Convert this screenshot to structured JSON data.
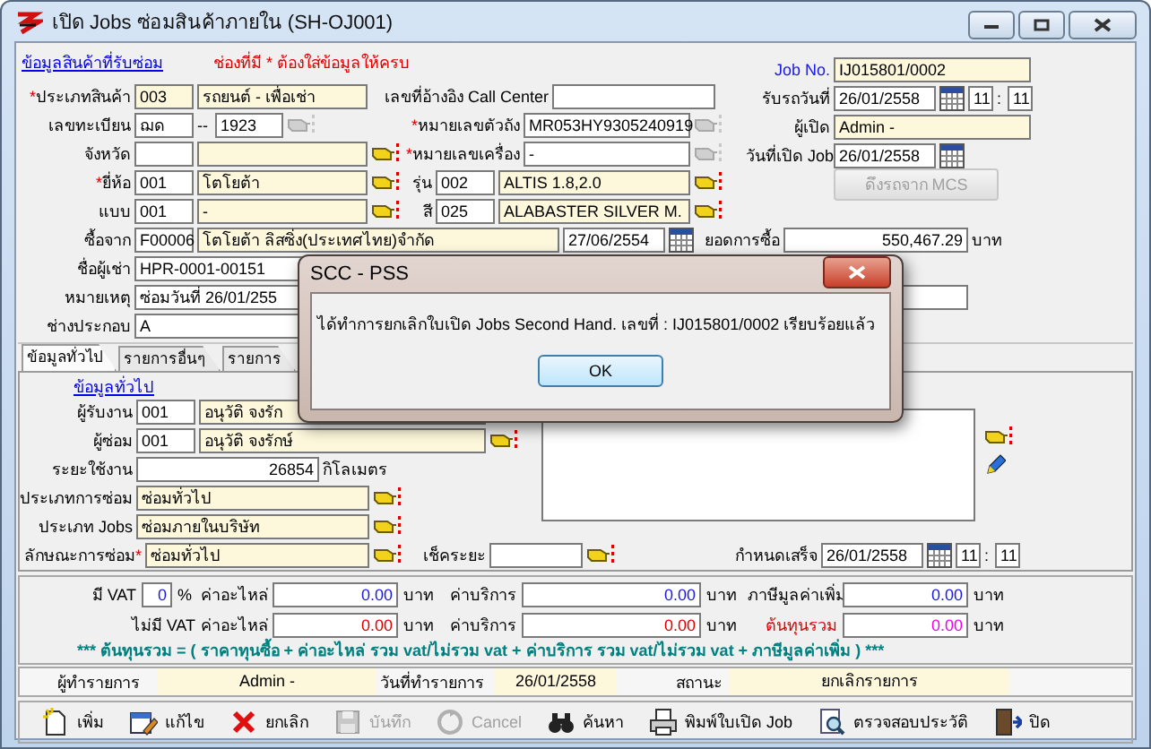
{
  "window": {
    "title": "เปิด Jobs ซ่อมสินค้าภายใน (SH-OJ001)"
  },
  "product_section": {
    "link": "ข้อมูลสินค้าที่รับซ่อม",
    "note": "ช่องที่มี * ต้องใส่ข้อมูลให้ครบ",
    "rows": [
      {
        "items": [
          {
            "kind": "label",
            "mark": "*",
            "text": "ประเภทสินค้า"
          },
          {
            "kind": "field",
            "value": "003",
            "readonly": true
          },
          {
            "kind": "field",
            "value": "รถยนต์ - เพื่อเช่า",
            "readonly": true
          },
          {
            "kind": "label",
            "text": "เลขที่อ้างอิง Call Center"
          },
          {
            "kind": "field",
            "readonly": false
          }
        ]
      },
      {
        "items": [
          {
            "kind": "label",
            "text": "เลขทะเบียน"
          },
          {
            "kind": "field",
            "value": "ฌด",
            "readonly": false
          },
          {
            "kind": "text",
            "text": "--"
          },
          {
            "kind": "field",
            "value": "1923",
            "readonly": false
          },
          {
            "kind": "picker",
            "disabled": true
          },
          {
            "kind": "label",
            "mark": "*",
            "text": "หมายเลขตัวถัง"
          },
          {
            "kind": "field",
            "value": "MR053HY9305240919",
            "readonly": false
          },
          {
            "kind": "picker",
            "disabled": true
          }
        ]
      },
      {
        "items": [
          {
            "kind": "label",
            "text": "จังหวัด"
          },
          {
            "kind": "field",
            "readonly": false
          },
          {
            "kind": "field",
            "readonly": true
          },
          {
            "kind": "picker",
            "disabled": false
          },
          {
            "kind": "label",
            "mark": "*",
            "text": "หมายเลขเครื่อง"
          },
          {
            "kind": "field",
            "value": "-",
            "readonly": false
          },
          {
            "kind": "picker",
            "disabled": true
          }
        ]
      },
      {
        "items": [
          {
            "kind": "label",
            "mark": "*",
            "text": "ยี่ห้อ"
          },
          {
            "kind": "field",
            "value": "001",
            "readonly": false
          },
          {
            "kind": "field",
            "value": "โตโยต้า",
            "readonly": true
          },
          {
            "kind": "picker",
            "disabled": false
          },
          {
            "kind": "label",
            "text": "รุ่น"
          },
          {
            "kind": "field",
            "value": "002",
            "readonly": false
          },
          {
            "kind": "field",
            "value": "ALTIS 1.8,2.0",
            "readonly": true
          },
          {
            "kind": "picker",
            "disabled": false
          }
        ]
      },
      {
        "items": [
          {
            "kind": "label",
            "text": "แบบ"
          },
          {
            "kind": "field",
            "value": "001",
            "readonly": false
          },
          {
            "kind": "field",
            "value": "-",
            "readonly": true
          },
          {
            "kind": "picker",
            "disabled": false
          },
          {
            "kind": "label",
            "text": "สี"
          },
          {
            "kind": "field",
            "value": "025",
            "readonly": false
          },
          {
            "kind": "field",
            "value": "ALABASTER SILVER M.",
            "readonly": true
          },
          {
            "kind": "picker",
            "disabled": false
          }
        ]
      }
    ],
    "job": [
      {
        "items": [
          {
            "kind": "label",
            "color": "#1a1ae6",
            "text": "Job No."
          },
          {
            "kind": "field",
            "value": "IJ015801/0002",
            "readonly": true
          }
        ]
      },
      {
        "items": [
          {
            "kind": "label",
            "text": "รับรถวันที่"
          },
          {
            "kind": "field",
            "value": "26/01/2558",
            "readonly": false
          },
          {
            "kind": "calendar"
          },
          {
            "kind": "field",
            "value": "11",
            "readonly": false
          },
          {
            "kind": "text",
            "text": ":"
          },
          {
            "kind": "field",
            "value": "11",
            "readonly": false
          }
        ]
      },
      {
        "items": [
          {
            "kind": "label",
            "text": "ผู้เปิด"
          },
          {
            "kind": "field",
            "value": "Admin -",
            "readonly": true
          }
        ]
      },
      {
        "items": [
          {
            "kind": "label",
            "text": "วันที่เปิด Job"
          },
          {
            "kind": "field",
            "value": "26/01/2558",
            "readonly": false
          },
          {
            "kind": "calendar"
          }
        ]
      },
      {
        "items": [
          {
            "kind": "button",
            "text": "ดึงรถจาก MCS",
            "disabled": true
          }
        ]
      }
    ],
    "more_rows": [
      {
        "items": [
          {
            "kind": "label",
            "text": "ซื้อจาก"
          },
          {
            "kind": "field",
            "value": "F00006",
            "readonly": false
          },
          {
            "kind": "field",
            "value": "โตโยต้า ลิสซิ่ง(ประเทศไทย)จำกัด",
            "readonly": true
          },
          {
            "kind": "field",
            "value": "27/06/2554",
            "readonly": false
          },
          {
            "kind": "calendar"
          },
          {
            "kind": "label",
            "text": "ยอดการซื้อ"
          },
          {
            "kind": "field",
            "value": "550,467.29",
            "readonly": false
          },
          {
            "kind": "text",
            "text": "บาท"
          }
        ]
      },
      {
        "items": [
          {
            "kind": "label",
            "text": "ชื่อผู้เช่า"
          },
          {
            "kind": "field",
            "value": "HPR-0001-00151",
            "readonly": false
          }
        ]
      },
      {
        "items": [
          {
            "kind": "label",
            "text": "หมายเหตุ"
          },
          {
            "kind": "field",
            "value": "ซ่อมวันที่ 26/01/255",
            "readonly": false
          }
        ]
      },
      {
        "items": [
          {
            "kind": "label",
            "text": "ช่างประกอบ"
          },
          {
            "kind": "field",
            "value": "A",
            "readonly": false
          }
        ]
      }
    ]
  },
  "tabs": [
    {
      "label": "ข้อมูลทั่วไป",
      "selected": true
    },
    {
      "label": "รายการอื่นๆ",
      "selected": false
    },
    {
      "label": "รายการ",
      "selected": false
    }
  ],
  "general": {
    "link": "ข้อมูลทั่วไป",
    "rows": [
      {
        "items": [
          {
            "kind": "label",
            "text": "ผู้รับงาน"
          },
          {
            "kind": "field",
            "value": "001",
            "readonly": false
          },
          {
            "kind": "field",
            "value": "อนุวัติ จงรัก",
            "readonly": true
          }
        ]
      },
      {
        "items": [
          {
            "kind": "label",
            "text": "ผู้ซ่อม"
          },
          {
            "kind": "field",
            "value": "001",
            "readonly": false
          },
          {
            "kind": "field",
            "value": "อนุวัติ จงรักษ์",
            "readonly": true
          },
          {
            "kind": "picker",
            "disabled": false
          }
        ]
      },
      {
        "items": [
          {
            "kind": "label",
            "text": "ระยะใช้งาน"
          },
          {
            "kind": "field",
            "value": "26854",
            "readonly": false
          },
          {
            "kind": "text",
            "text": "กิโลเมตร"
          }
        ]
      },
      {
        "items": [
          {
            "kind": "label",
            "text": "ประเภทการซ่อม"
          },
          {
            "kind": "field",
            "value": "ซ่อมทั่วไป",
            "readonly": true
          },
          {
            "kind": "picker",
            "disabled": false
          }
        ]
      },
      {
        "items": [
          {
            "kind": "label",
            "text": "ประเภท Jobs"
          },
          {
            "kind": "field",
            "value": "ซ่อมภายในบริษัท",
            "readonly": true
          },
          {
            "kind": "picker",
            "disabled": false
          }
        ]
      }
    ],
    "bottom_row": {
      "items": [
        {
          "kind": "label",
          "mark_after": "*",
          "text": "ลักษณะการซ่อม"
        },
        {
          "kind": "field",
          "value": "ซ่อมทั่วไป",
          "readonly": true
        },
        {
          "kind": "picker",
          "disabled": false
        },
        {
          "kind": "label",
          "text": "เช็คระยะ"
        },
        {
          "kind": "field",
          "readonly": false
        },
        {
          "kind": "picker",
          "disabled": false
        },
        {
          "kind": "label",
          "text": "กำหนดเสร็จ"
        },
        {
          "kind": "field",
          "value": "26/01/2558",
          "readonly": false
        },
        {
          "kind": "calendar"
        },
        {
          "kind": "field",
          "value": "11",
          "readonly": false
        },
        {
          "kind": "text",
          "text": ":"
        },
        {
          "kind": "field",
          "value": "11",
          "readonly": false
        }
      ]
    }
  },
  "costs": {
    "rows": [
      {
        "items": [
          {
            "kind": "label",
            "text": "มี VAT"
          },
          {
            "kind": "field",
            "value": "0",
            "color": "#1a1ae6",
            "readonly": false
          },
          {
            "kind": "text",
            "text": "%"
          },
          {
            "kind": "label",
            "text": "ค่าอะไหล่"
          },
          {
            "kind": "field",
            "value": "0.00",
            "color": "#1a1ae6",
            "readonly": false
          },
          {
            "kind": "text",
            "text": "บาท"
          },
          {
            "kind": "label",
            "text": "ค่าบริการ"
          },
          {
            "kind": "field",
            "value": "0.00",
            "color": "#1a1ae6",
            "readonly": false
          },
          {
            "kind": "text",
            "text": "บาท"
          },
          {
            "kind": "label",
            "text": "ภาษีมูลค่าเพิ่ม"
          },
          {
            "kind": "field",
            "value": "0.00",
            "color": "#1a1ae6",
            "readonly": false
          },
          {
            "kind": "text",
            "text": "บาท"
          }
        ]
      },
      {
        "items": [
          {
            "kind": "label",
            "text": "ไม่มี VAT"
          },
          {
            "kind": "label",
            "text": "ค่าอะไหล่"
          },
          {
            "kind": "field",
            "value": "0.00",
            "color": "#e00000",
            "readonly": false
          },
          {
            "kind": "text",
            "text": "บาท"
          },
          {
            "kind": "label",
            "text": "ค่าบริการ"
          },
          {
            "kind": "field",
            "value": "0.00",
            "color": "#e00000",
            "readonly": false
          },
          {
            "kind": "text",
            "text": "บาท"
          },
          {
            "kind": "label",
            "color": "#e00000",
            "text": "ต้นทุนรวม"
          },
          {
            "kind": "field",
            "value": "0.00",
            "color": "#f000f0",
            "readonly": false
          },
          {
            "kind": "text",
            "text": "บาท"
          }
        ]
      }
    ],
    "formula": "***  ต้นทุนรวม = ( ราคาทุนซื้อ  +  ค่าอะไหล่ รวม vat/ไม่รวม vat  +  ค่าบริการ  รวม vat/ไม่รวม vat  +  ภาษีมูลค่าเพิ่ม )  ***"
  },
  "status_bar": [
    {
      "label": "ผู้ทำรายการ",
      "value": "Admin -"
    },
    {
      "label": "วันที่ทำรายการ",
      "value": "26/01/2558"
    },
    {
      "label": "สถานะ",
      "value": "ยกเลิกรายการ"
    }
  ],
  "toolbar": [
    {
      "kind": "add",
      "label": "เพิ่ม",
      "disabled": false
    },
    {
      "kind": "edit",
      "label": "แก้ไข",
      "disabled": false
    },
    {
      "kind": "delete",
      "label": "ยกเลิก",
      "disabled": false
    },
    {
      "kind": "save",
      "label": "บันทึก",
      "disabled": true
    },
    {
      "kind": "cancel",
      "label": "Cancel",
      "disabled": true
    },
    {
      "kind": "search",
      "label": "ค้นหา",
      "disabled": false
    },
    {
      "kind": "print",
      "label": "พิมพ์ใบเปิด Job",
      "disabled": false
    },
    {
      "kind": "history",
      "label": "ตรวจสอบประวัติ",
      "disabled": false
    },
    {
      "kind": "exit",
      "label": "ปิด",
      "disabled": false
    }
  ],
  "dialog": {
    "title": "SCC - PSS",
    "message": "ได้ทำการยกเลิกใบเปิด Jobs Second Hand. เลขที่ : IJ015801/0002 เรียบร้อยแล้ว",
    "button": "OK"
  }
}
